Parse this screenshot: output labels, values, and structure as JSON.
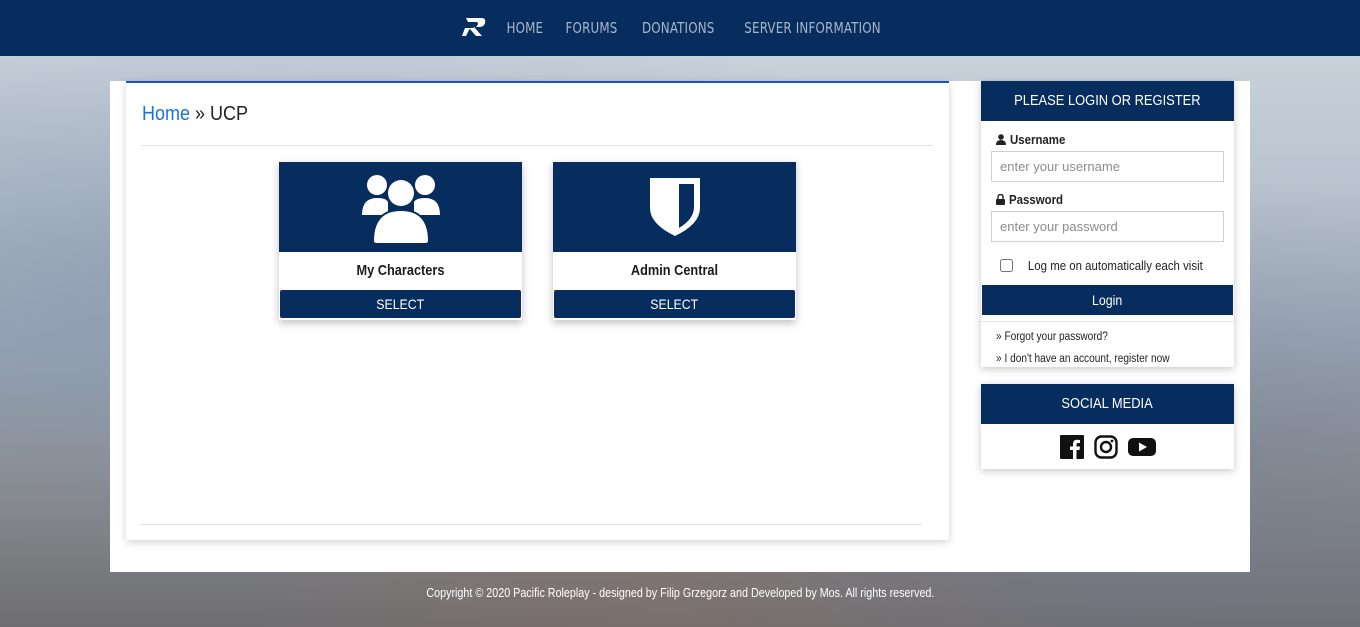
{
  "nav": {
    "items": [
      {
        "label": "HOME"
      },
      {
        "label": "FORUMS"
      },
      {
        "label": "DONATIONS"
      },
      {
        "label": "SERVER INFORMATION"
      }
    ]
  },
  "breadcrumb": {
    "home": "Home",
    "separator": "»",
    "current": "UCP"
  },
  "cards": [
    {
      "title": "My Characters",
      "button": "SELECT",
      "icon": "users-group-icon"
    },
    {
      "title": "Admin Central",
      "button": "SELECT",
      "icon": "shield-icon"
    }
  ],
  "login": {
    "heading": "PLEASE LOGIN OR REGISTER",
    "username_label": "Username",
    "username_placeholder": "enter your username",
    "password_label": "Password",
    "password_placeholder": "enter your password",
    "remember_label": "Log me on automatically each visit",
    "login_button": "Login",
    "forgot_link": "» Forgot your password?",
    "register_link": "» I don't have an account, register now"
  },
  "social": {
    "heading": "SOCIAL MEDIA",
    "icons": [
      "facebook-icon",
      "instagram-icon",
      "youtube-icon"
    ]
  },
  "footer": {
    "text": "Copyright © 2020 Pacific Roleplay - designed by Filip Grzegorz and Developed by Mos. All rights reserved."
  },
  "colors": {
    "brand_navy": "#062d5e",
    "link_blue": "#1a73d9",
    "nav_text": "#a9b6c8"
  }
}
